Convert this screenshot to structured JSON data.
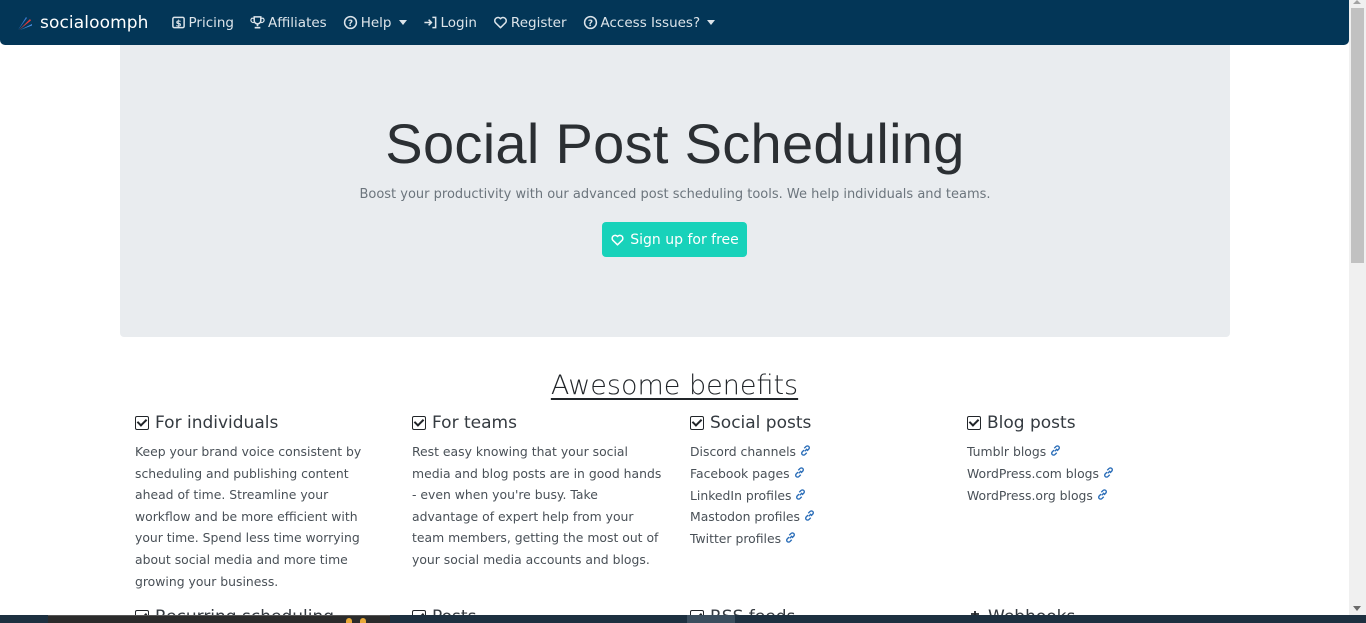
{
  "navbar": {
    "brand": "socialoomph",
    "items": [
      {
        "label": "Pricing",
        "icon": "dollar-box-icon",
        "dropdown": false
      },
      {
        "label": "Affiliates",
        "icon": "trophy-icon",
        "dropdown": false
      },
      {
        "label": "Help",
        "icon": "question-circle-icon",
        "dropdown": true
      },
      {
        "label": "Login",
        "icon": "sign-in-icon",
        "dropdown": false
      },
      {
        "label": "Register",
        "icon": "heart-icon",
        "dropdown": false
      },
      {
        "label": "Access Issues?",
        "icon": "question-circle-icon",
        "dropdown": true
      }
    ],
    "background": "#033657"
  },
  "hero": {
    "title": "Social Post Scheduling",
    "lead": "Boost your productivity with our advanced post scheduling tools. We help individuals and teams.",
    "cta_label": "Sign up for free",
    "cta_color": "#18d2ba"
  },
  "benefits": {
    "title": "Awesome benefits",
    "columns": [
      {
        "heading": "For individuals",
        "text": "Keep your brand voice consistent by scheduling and publishing content ahead of time. Streamline your workflow and be more efficient with your time. Spend less time worrying about social media and more time growing your business."
      },
      {
        "heading": "For teams",
        "text": "Rest easy knowing that your social media and blog posts are in good hands - even when you're busy. Take advantage of expert help from your team members, getting the most out of your social media accounts and blogs."
      },
      {
        "heading": "Social posts",
        "links": [
          "Discord channels",
          "Facebook pages",
          "LinkedIn profiles",
          "Mastodon profiles",
          "Twitter profiles"
        ]
      },
      {
        "heading": "Blog posts",
        "links": [
          "Tumblr blogs",
          "WordPress.com blogs",
          "WordPress.org blogs"
        ]
      }
    ],
    "second_row_headings": [
      "Recurring scheduling",
      "Posts",
      "RSS feeds",
      "Webhooks"
    ]
  }
}
